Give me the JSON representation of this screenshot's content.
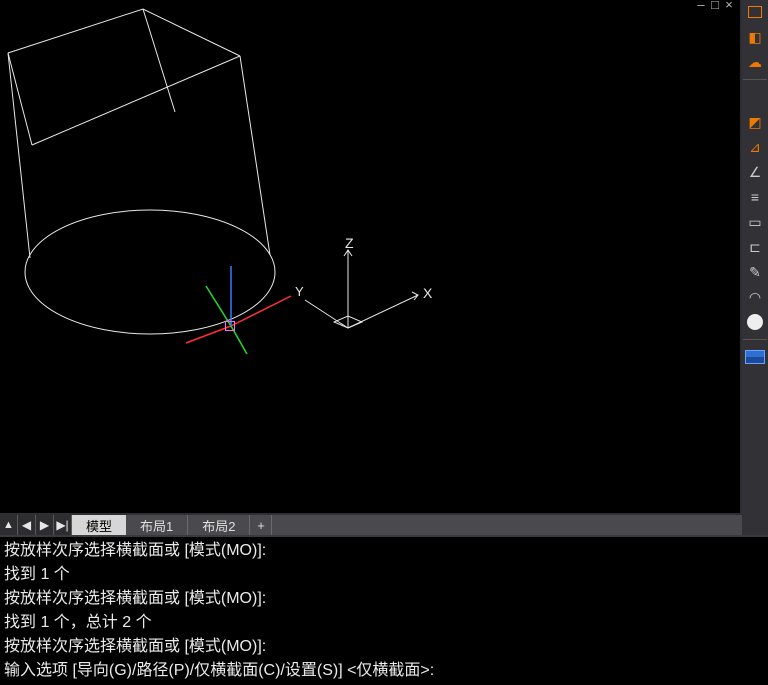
{
  "viewport": {
    "axis_labels": {
      "z": "Z",
      "x": "X",
      "y": "Y"
    },
    "view_controls": {
      "min": "–",
      "restore": "□",
      "close": "×"
    }
  },
  "tabs": {
    "nav": {
      "first": "▲",
      "prev": "◀",
      "next": "▶",
      "last": "▶|"
    },
    "items": [
      {
        "label": "模型",
        "active": true
      },
      {
        "label": "布局1",
        "active": false
      },
      {
        "label": "布局2",
        "active": false
      }
    ],
    "add": "+"
  },
  "toolbar": {
    "icons": [
      "cube-icon",
      "shape-icon",
      "cloud-icon",
      "square-icon",
      "chamfer-icon",
      "join-icon",
      "angle-icon",
      "lines-icon",
      "rect-icon",
      "rect-open-icon",
      "edge-icon",
      "arc-icon",
      "circle-icon",
      "tablue-icon"
    ]
  },
  "command": {
    "lines": [
      "按放样次序选择横截面或 [模式(MO)]:",
      "找到 1 个",
      "按放样次序选择横截面或 [模式(MO)]:",
      "找到 1 个，总计 2 个",
      "按放样次序选择横截面或 [模式(MO)]:",
      "输入选项 [导向(G)/路径(P)/仅横截面(C)/设置(S)] <仅横截面>:"
    ]
  }
}
